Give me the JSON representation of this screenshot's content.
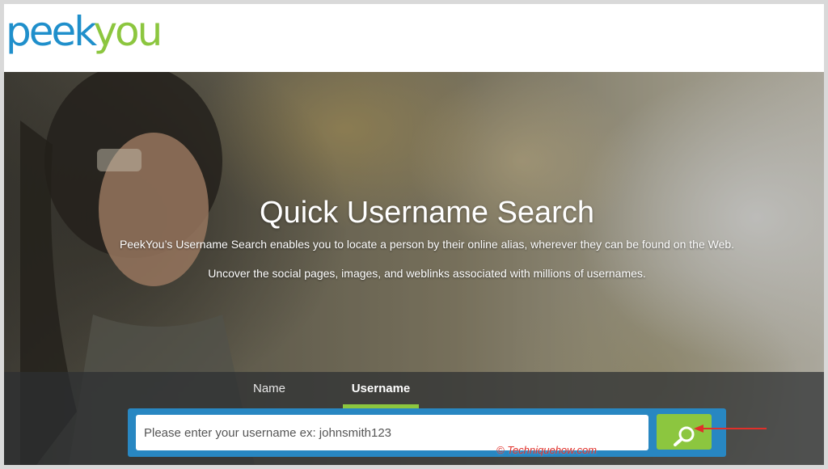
{
  "logo": {
    "part1": "peek",
    "part2": "you"
  },
  "hero": {
    "title": "Quick Username Search",
    "description_line1": "PeekYou’s Username Search enables you to locate a person by their online alias, wherever they can be found on the Web.",
    "description_line2": "Uncover the social pages, images, and weblinks associated with millions of usernames."
  },
  "search": {
    "tabs": [
      {
        "label": "Name",
        "active": false
      },
      {
        "label": "Username",
        "active": true
      }
    ],
    "placeholder": "Please enter your username ex: johnsmith123",
    "value": "",
    "button_icon": "search-icon"
  },
  "annotation": {
    "arrow_color": "#e0302a"
  },
  "watermark": "© Techniquehow.com",
  "colors": {
    "brand_blue": "#1f8fcb",
    "brand_green": "#8cc63f",
    "search_frame": "#2887c2"
  }
}
